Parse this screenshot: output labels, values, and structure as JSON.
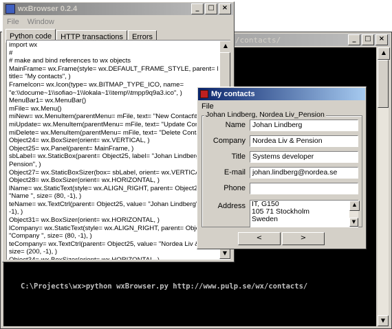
{
  "console": {
    "title": "/contacts/",
    "command": "C:\\Projects\\wx>python wxBrowser.py http://www.pulp.se/wx/contacts/"
  },
  "browser": {
    "title": "wxBrowser 0.2.4",
    "menu": [
      "File",
      "Window"
    ],
    "tabs": [
      "Python code",
      "HTTP transactions",
      "Errors"
    ],
    "code_lines": [
      "import wx",
      "",
      "#",
      "# make and bind references to wx objects",
      "",
      "MainFrame= wx.Frame(style= wx.DEFAULT_FRAME_STYLE, parent= None,",
      "title= \"My contacts\", )",
      "FrameIcon= wx.Icon(type= wx.BITMAP_TYPE_ICO, name=",
      "\"e:\\\\docume~1\\\\sofiao~1\\\\lokala~1\\\\temp\\\\tmpp9q9a3.ico\", )",
      "MenuBar1= wx.MenuBar()",
      "mFile= wx.Menu()",
      "miNew= wx.MenuItem(parentMenu= mFile, text= \"New Contact\\tCtrl+N\"",
      "miUpdate= wx.MenuItem(parentMenu= mFile, text= \"Update Contact\", )",
      "miDelete= wx.MenuItem(parentMenu= mFile, text= \"Delete Contact\", )",
      "Object24= wx.BoxSizer(orient= wx.VERTICAL, )",
      "Object25= wx.Panel(parent= MainFrame, )",
      "sbLabel= wx.StaticBox(parent= Object25, label= \"Johan Lindberg, Norc",
      "Pension\", )",
      "Object27= wx.StaticBoxSizer(box= sbLabel, orient= wx.VERTICAL, )",
      "Object28= wx.BoxSizer(orient= wx.HORIZONTAL, )",
      "lName= wx.StaticText(style= wx.ALIGN_RIGHT, parent= Object25, labe",
      "\"Name \", size= (80, -1), )",
      "teName= wx.TextCtrl(parent= Object25, value= \"Johan Lindberg\", size=",
      "-1), )",
      "Object31= wx.BoxSizer(orient= wx.HORIZONTAL, )",
      "lCompany= wx.StaticText(style= wx.ALIGN_RIGHT, parent= Object25,",
      "\"Company \", size= (80, -1), )",
      "teCompany= wx.TextCtrl(parent= Object25, value= \"Nordea Liv & Pensi",
      "size= (200, -1), )",
      "Object34= wx.BoxSizer(orient= wx.HORIZONTAL, )"
    ]
  },
  "contacts": {
    "title": "My contacts",
    "menu": [
      "File"
    ],
    "group_label": "Johan Lindberg, Nordea Liv_Pension",
    "fields": [
      {
        "label": "Name",
        "value": "Johan Lindberg"
      },
      {
        "label": "Company",
        "value": "Nordea Liv & Pension"
      },
      {
        "label": "Title",
        "value": "Systems developer"
      },
      {
        "label": "E-mail",
        "value": "johan.lindberg@nordea.se"
      },
      {
        "label": "Phone",
        "value": ""
      }
    ],
    "address_label": "Address",
    "address_lines": [
      "IT, G150",
      "105 71 Stockholm",
      "Sweden"
    ],
    "prev_label": "<",
    "next_label": ">"
  },
  "colors": {
    "title_active": "#0a246a",
    "title_inactive": "#808080",
    "console_bg": "#000000",
    "console_text": "#c0c0c0",
    "face": "#d4d0c8"
  },
  "icons": {
    "minimize": "minimize-icon",
    "maximize": "maximize-icon",
    "close": "close-icon",
    "app": "app-icon"
  }
}
